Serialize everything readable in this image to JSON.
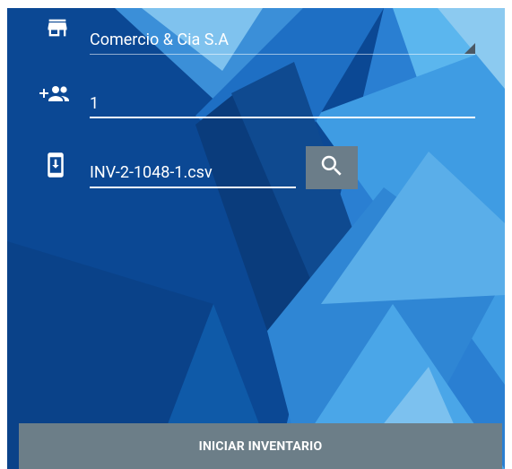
{
  "form": {
    "company": {
      "icon": "store-icon",
      "value": "Comercio & Cia S.A"
    },
    "people": {
      "icon": "add-people-icon",
      "value": "1"
    },
    "file": {
      "icon": "phone-download-icon",
      "value": "INV-2-1048-1.csv",
      "search_icon": "search-icon"
    }
  },
  "actions": {
    "start_label": "INICIAR INVENTARIO"
  },
  "colors": {
    "background_dark": "#0d4b98",
    "background_light": "#3e9be0",
    "button_gray": "#6c7e88",
    "text": "#ffffff"
  }
}
